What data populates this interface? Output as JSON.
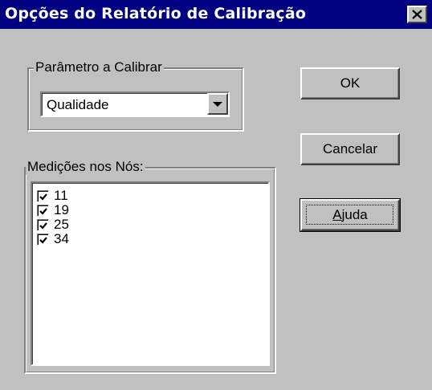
{
  "dialog": {
    "title": "Opções do Relatório de Calibração",
    "close_icon": "close-icon",
    "colors": {
      "titlebar": "#000080",
      "face": "#c0c0c0"
    }
  },
  "parameter_group": {
    "label": "Parâmetro a Calibrar",
    "combo_value": "Qualidade",
    "arrow_icon": "chevron-down-icon"
  },
  "measurements_group": {
    "label": "Medições nos Nós:",
    "items": [
      {
        "label": "11",
        "checked": true
      },
      {
        "label": "19",
        "checked": true
      },
      {
        "label": "25",
        "checked": true
      },
      {
        "label": "34",
        "checked": true
      }
    ]
  },
  "buttons": {
    "ok": "OK",
    "cancel": "Cancelar",
    "help_first": "A",
    "help_rest": "juda"
  }
}
